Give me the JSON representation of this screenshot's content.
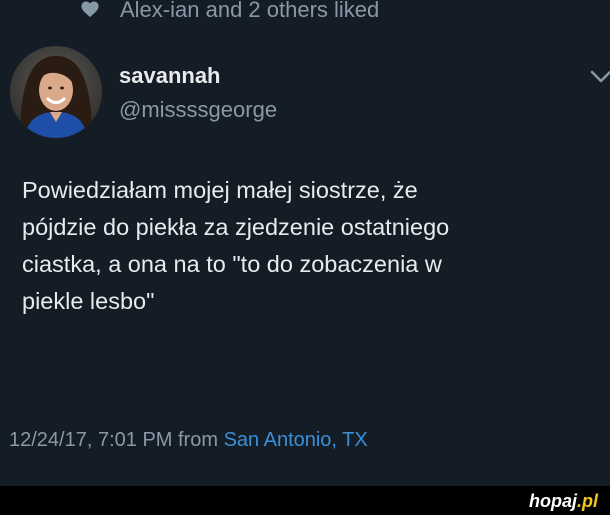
{
  "liked": {
    "icon": "heart-icon",
    "text": "Alex-ian and 2 others liked"
  },
  "author": {
    "display_name": "savannah",
    "handle": "@missssgeorge",
    "avatar": "avatar-photo"
  },
  "tweet": {
    "lines": [
      "Powiedziałam mojej małej siostrze, że",
      "pójdzie do piekła za zjedzenie ostatniego",
      "ciastka, a ona na to \"to do zobaczenia w",
      "piekle lesbo\""
    ]
  },
  "meta": {
    "date_text": "12/24/17, 7:01 PM from ",
    "location": "San Antonio, TX"
  },
  "watermark": {
    "name": "hopaj",
    "tld": ".pl"
  },
  "colors": {
    "background": "#141d26",
    "text_primary": "#e8eaed",
    "text_secondary": "#8899a6",
    "link": "#3a8fd9",
    "brand_accent": "#f5c518"
  }
}
